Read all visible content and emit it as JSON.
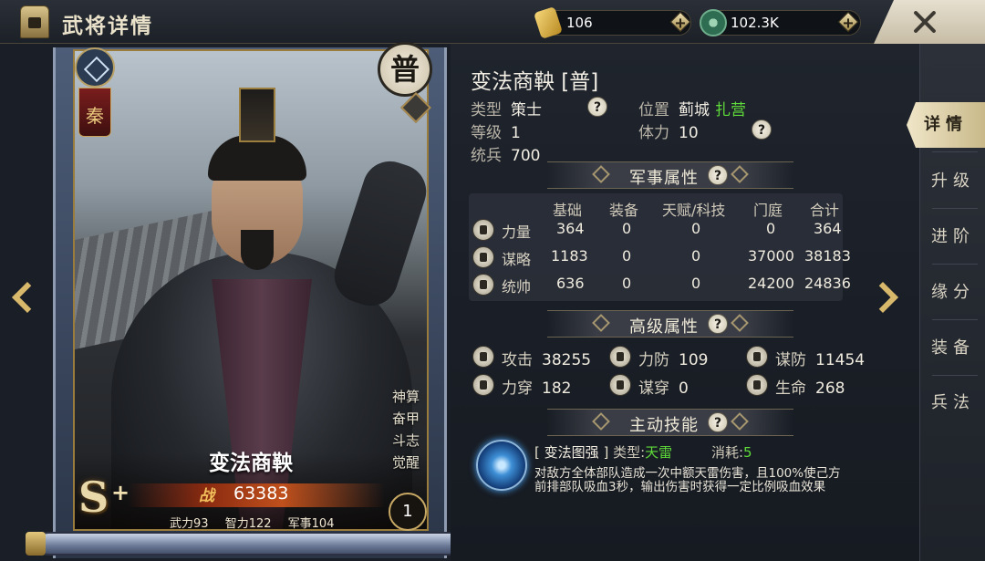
{
  "header": {
    "title": "武将详情",
    "gold": "106",
    "coins": "102.3K"
  },
  "card": {
    "faction": "秦",
    "rarity": "普",
    "name": "变法商鞅",
    "power_label": "战",
    "power": "63383",
    "grade": "S",
    "grade_plus": "+",
    "level": "1",
    "talents": [
      "神算",
      "奋甲",
      "斗志",
      "觉醒"
    ],
    "base_stats": {
      "force": "武力93",
      "intellect": "智力122",
      "military": "军事104"
    }
  },
  "info": {
    "hero_title": "变法商鞅 [普]",
    "type_label": "类型",
    "type_value": "策士",
    "position_label": "位置",
    "position_city": "蓟城",
    "position_status": "扎营",
    "level_label": "等级",
    "level_value": "1",
    "stamina_label": "体力",
    "stamina_value": "10",
    "troops_label": "统兵",
    "troops_value": "700"
  },
  "military": {
    "title": "军事属性",
    "columns": [
      "基础",
      "装备",
      "天赋/科技",
      "门庭",
      "合计"
    ],
    "rows": [
      {
        "label": "力量",
        "values": [
          "364",
          "0",
          "0",
          "0",
          "364"
        ]
      },
      {
        "label": "谋略",
        "values": [
          "1183",
          "0",
          "0",
          "37000",
          "38183"
        ]
      },
      {
        "label": "统帅",
        "values": [
          "636",
          "0",
          "0",
          "24200",
          "24836"
        ]
      }
    ]
  },
  "advanced": {
    "title": "高级属性",
    "items": [
      {
        "label": "攻击",
        "value": "38255"
      },
      {
        "label": "力防",
        "value": "109"
      },
      {
        "label": "谋防",
        "value": "11454"
      },
      {
        "label": "力穿",
        "value": "182"
      },
      {
        "label": "谋穿",
        "value": "0"
      },
      {
        "label": "生命",
        "value": "268"
      }
    ]
  },
  "skill": {
    "title": "主动技能",
    "open_bracket": "[",
    "name": "变法图强",
    "close_bracket": "]",
    "type_label": "类型:",
    "type_value": "天雷",
    "cost_label": "消耗:",
    "cost_value": "5",
    "description": "对敌方全体部队造成一次中额天雷伤害，且100%使己方前排部队吸血3秒，输出伤害时获得一定比例吸血效果"
  },
  "tabs": [
    "详情",
    "升级",
    "进阶",
    "缘分",
    "装备",
    "兵法"
  ],
  "help_glyph": "?"
}
